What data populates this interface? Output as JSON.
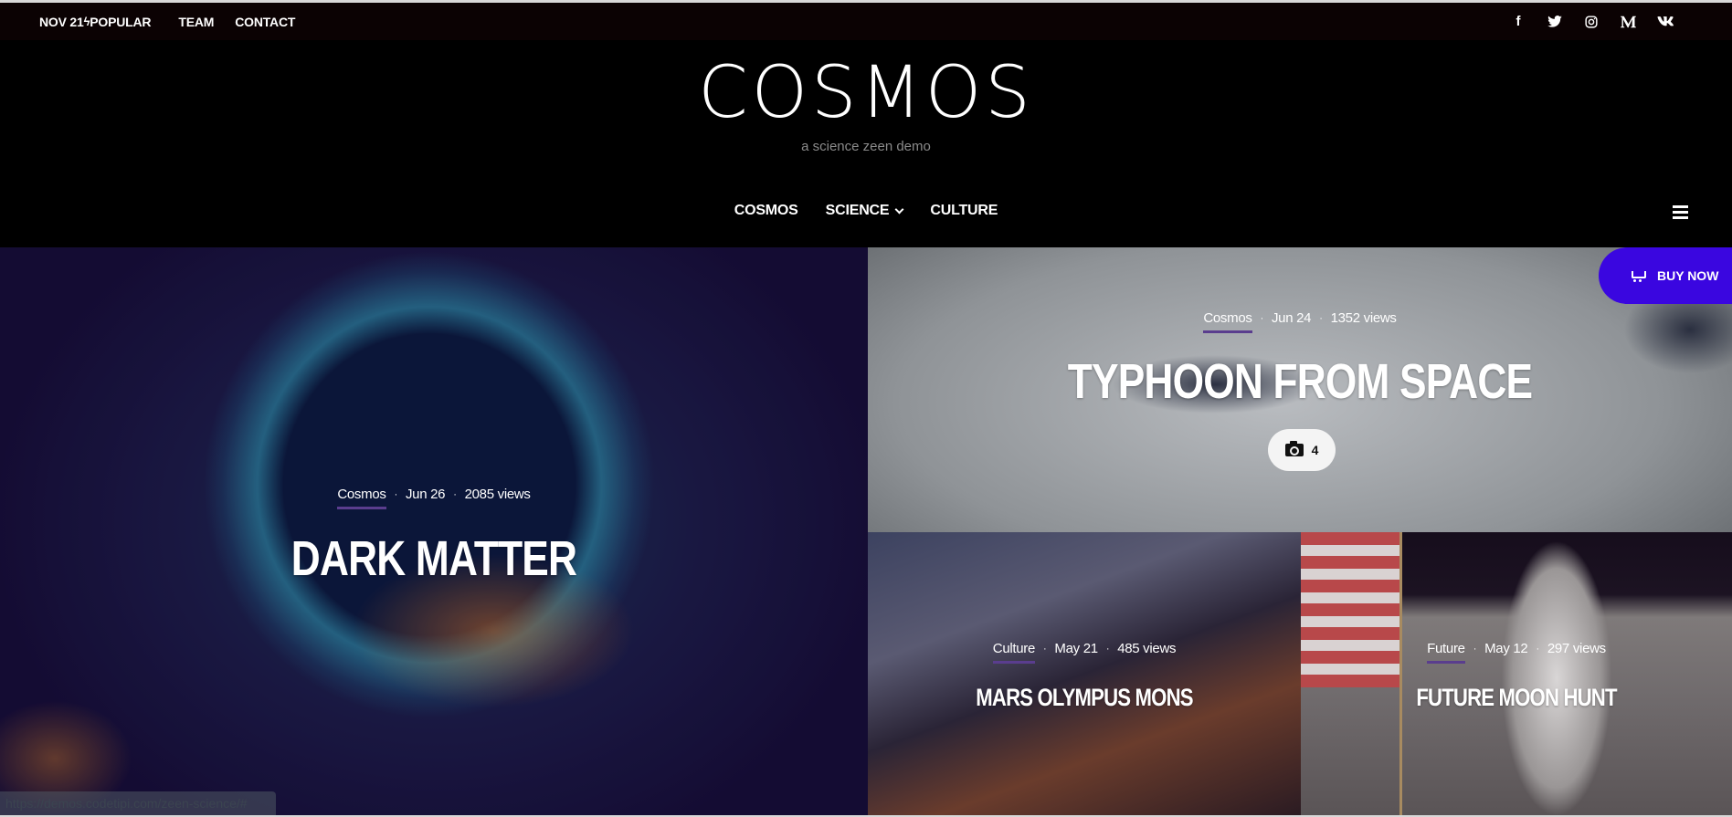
{
  "topbar": {
    "date": "NOV 21",
    "popular_icon": "bolt-icon",
    "popular": "POPULAR",
    "team": "TEAM",
    "contact": "CONTACT",
    "social": [
      {
        "name": "facebook-icon",
        "glyph": "f"
      },
      {
        "name": "twitter-icon",
        "glyph": "🐦"
      },
      {
        "name": "instagram-icon",
        "glyph": "◎"
      },
      {
        "name": "medium-icon",
        "glyph": "M"
      },
      {
        "name": "vk-icon",
        "glyph": "vk"
      }
    ]
  },
  "header": {
    "logo": "COSMOS",
    "tagline": "a science zeen demo"
  },
  "nav": {
    "items": [
      "COSMOS",
      "SCIENCE",
      "CULTURE"
    ],
    "menu_icon": "hamburger-icon"
  },
  "buy_now": {
    "label": "BUY NOW",
    "icon": "cart-icon",
    "color": "#3a06e0"
  },
  "posts": [
    {
      "category": "Cosmos",
      "date": "Jun 26",
      "views": "2085 views",
      "title": "DARK MATTER"
    },
    {
      "category": "Cosmos",
      "date": "Jun 24",
      "views": "1352 views",
      "title": "TYPHOON FROM SPACE",
      "gallery_count": "4"
    },
    {
      "category": "Culture",
      "date": "May 21",
      "views": "485 views",
      "title": "MARS OLYMPUS MONS"
    },
    {
      "category": "Future",
      "date": "May 12",
      "views": "297 views",
      "title": "FUTURE MOON HUNT"
    }
  ],
  "meta_separator": "·",
  "accent_color": "#5a3d8e",
  "status_url": "https://demos.codetipi.com/zeen-science/#"
}
